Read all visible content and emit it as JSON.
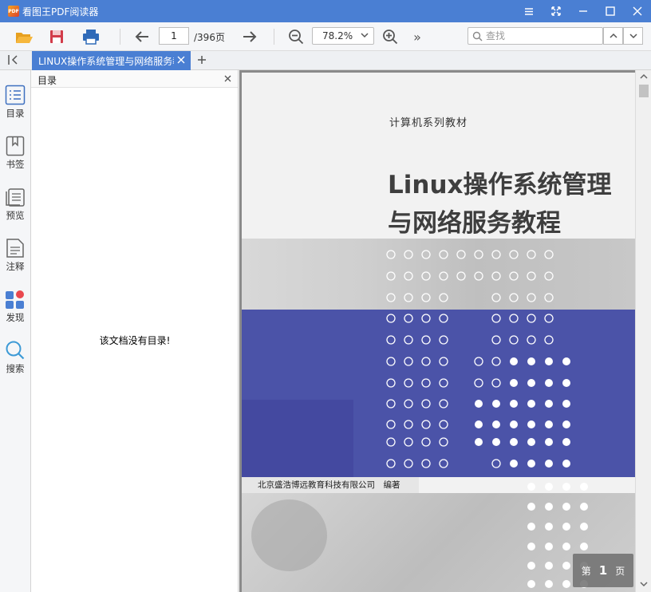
{
  "app": {
    "title": "看图王PDF阅读器",
    "logo_text": "PDF"
  },
  "toolbar": {
    "open_icon": "folder-open-icon",
    "save_icon": "save-icon",
    "print_icon": "print-icon",
    "prev_icon": "arrow-left-icon",
    "next_icon": "arrow-right-icon",
    "current_page": "1",
    "total_pages": "/396页",
    "zoom_out_icon": "zoom-out-icon",
    "zoom_value": "78.2%",
    "zoom_in_icon": "zoom-in-icon",
    "more_label": "»",
    "search_placeholder": "查找"
  },
  "tabs": [
    {
      "label": "LINUX操作系统管理与网络服务教程",
      "active": true
    }
  ],
  "sidebar": {
    "items": [
      {
        "label": "目录",
        "icon": "toc-icon"
      },
      {
        "label": "书签",
        "icon": "bookmark-icon"
      },
      {
        "label": "预览",
        "icon": "preview-icon"
      },
      {
        "label": "注释",
        "icon": "annotation-icon"
      },
      {
        "label": "发现",
        "icon": "discover-icon"
      },
      {
        "label": "搜索",
        "icon": "search-icon"
      }
    ]
  },
  "toc": {
    "title": "目录",
    "empty_message": "该文档没有目录!"
  },
  "document": {
    "series": "计算机系列教材",
    "title_line1": "Linux操作系统管理",
    "title_line2": "与网络服务教程",
    "publisher": "北京盛浩博远教育科技有限公司　编著"
  },
  "page_indicator": {
    "prefix": "第",
    "page": "1",
    "suffix": "页"
  },
  "colors": {
    "accent": "#4a7fd3",
    "cover_blue": "#4b53a8"
  }
}
